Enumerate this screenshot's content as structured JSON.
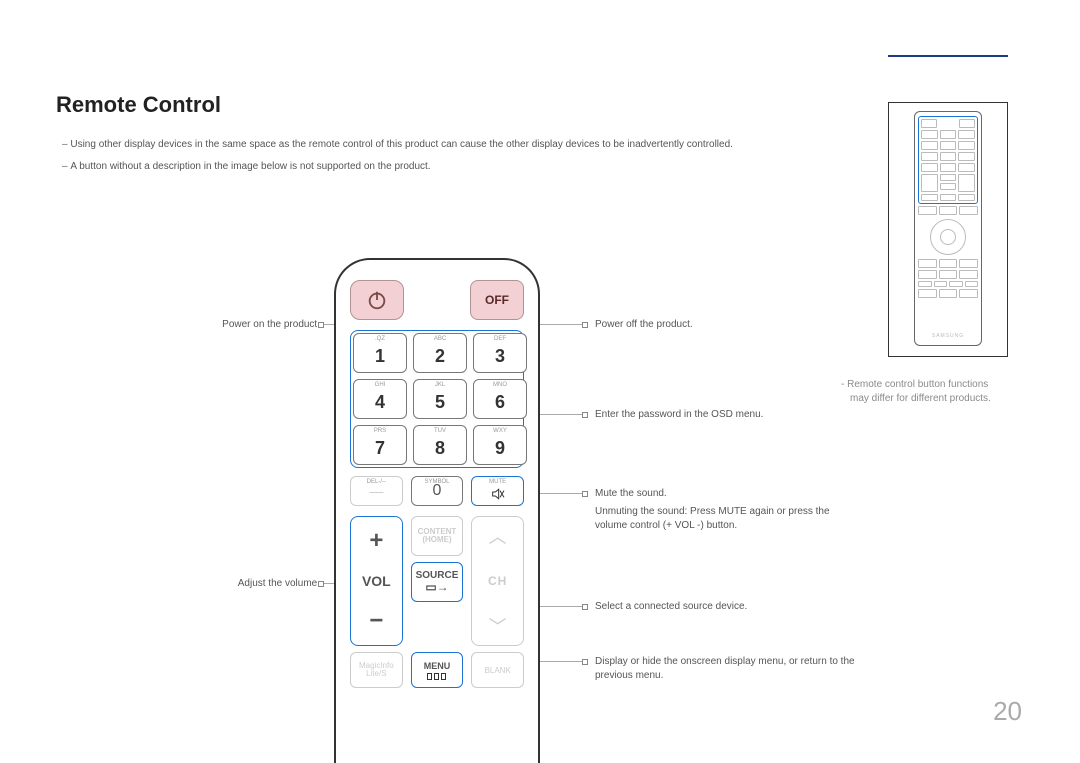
{
  "page": {
    "title": "Remote Control",
    "number": "20"
  },
  "notes": [
    "Using other display devices in the same space as the remote control of this product can cause the other display devices to be inadvertently controlled.",
    "A button without a description in the image below is not supported on the product."
  ],
  "side_note": "Remote control button functions may differ for different products.",
  "callouts": {
    "power_on": "Power on the product.",
    "power_off": "Power off the product.",
    "password": "Enter the password in the OSD menu.",
    "mute": "Mute the sound.",
    "mute2": "Unmuting the sound: Press MUTE again or press the volume control (+ VOL -) button.",
    "volume": "Adjust the volume.",
    "source": "Select a connected source device.",
    "menu": "Display or hide the onscreen display menu, or return to the previous menu."
  },
  "remote": {
    "off": "OFF",
    "keypad": [
      {
        "d": "1",
        "s": ".QZ"
      },
      {
        "d": "2",
        "s": "ABC"
      },
      {
        "d": "3",
        "s": "DEF"
      },
      {
        "d": "4",
        "s": "GHI"
      },
      {
        "d": "5",
        "s": "JKL"
      },
      {
        "d": "6",
        "s": "MNO"
      },
      {
        "d": "7",
        "s": "PRS"
      },
      {
        "d": "8",
        "s": "TUV"
      },
      {
        "d": "9",
        "s": "WXY"
      }
    ],
    "del": "DEL-/--",
    "symbol": "SYMBOL",
    "zero": "0",
    "mute": "MUTE",
    "vol": "VOL",
    "ch": "CH",
    "content": "CONTENT",
    "home": "(HOME)",
    "source": "SOURCE",
    "menu": "MENU",
    "magic1": "MagicInfo",
    "magic2": "Lite/S",
    "blank": "BLANK",
    "brand": "SAMSUNG"
  }
}
